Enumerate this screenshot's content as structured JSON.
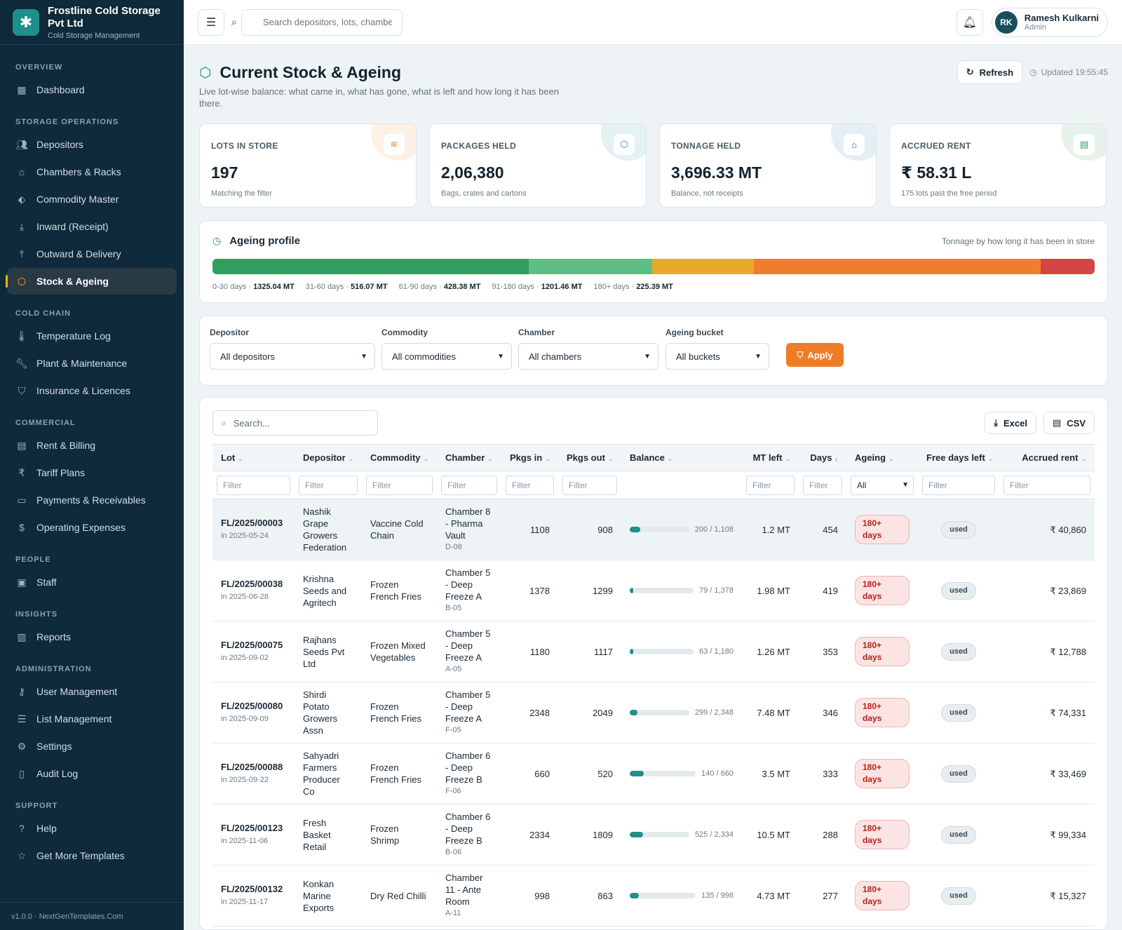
{
  "brand": {
    "name": "Frostline Cold Storage Pvt Ltd",
    "subtitle": "Cold Storage Management"
  },
  "sidebar": {
    "sections": [
      {
        "label": "OVERVIEW",
        "items": [
          {
            "label": "Dashboard",
            "icon": "dashboard-icon"
          }
        ]
      },
      {
        "label": "STORAGE OPERATIONS",
        "items": [
          {
            "label": "Depositors",
            "icon": "users-icon"
          },
          {
            "label": "Chambers & Racks",
            "icon": "warehouse-icon"
          },
          {
            "label": "Commodity Master",
            "icon": "tag-icon"
          },
          {
            "label": "Inward (Receipt)",
            "icon": "download-icon"
          },
          {
            "label": "Outward & Delivery",
            "icon": "upload-icon"
          },
          {
            "label": "Stock & Ageing",
            "icon": "box-icon",
            "active": true
          }
        ]
      },
      {
        "label": "COLD CHAIN",
        "items": [
          {
            "label": "Temperature Log",
            "icon": "thermometer-icon"
          },
          {
            "label": "Plant & Maintenance",
            "icon": "wrench-icon"
          },
          {
            "label": "Insurance & Licences",
            "icon": "shield-icon"
          }
        ]
      },
      {
        "label": "COMMERCIAL",
        "items": [
          {
            "label": "Rent & Billing",
            "icon": "receipt-icon"
          },
          {
            "label": "Tariff Plans",
            "icon": "rupee-icon"
          },
          {
            "label": "Payments & Receivables",
            "icon": "wallet-icon"
          },
          {
            "label": "Operating Expenses",
            "icon": "dollar-icon"
          }
        ]
      },
      {
        "label": "PEOPLE",
        "items": [
          {
            "label": "Staff",
            "icon": "id-card-icon"
          }
        ]
      },
      {
        "label": "INSIGHTS",
        "items": [
          {
            "label": "Reports",
            "icon": "bar-chart-icon"
          }
        ]
      },
      {
        "label": "ADMINISTRATION",
        "items": [
          {
            "label": "User Management",
            "icon": "key-icon"
          },
          {
            "label": "List Management",
            "icon": "list-icon"
          },
          {
            "label": "Settings",
            "icon": "gear-icon"
          },
          {
            "label": "Audit Log",
            "icon": "clipboard-icon"
          }
        ]
      },
      {
        "label": "SUPPORT",
        "items": [
          {
            "label": "Help",
            "icon": "help-icon"
          },
          {
            "label": "Get More Templates",
            "icon": "star-icon"
          }
        ]
      }
    ],
    "footer": "v1.0.0 · NextGenTemplates.Com"
  },
  "topbar": {
    "search_placeholder": "Search depositors, lots, chambers",
    "user": {
      "initials": "RK",
      "name": "Ramesh Kulkarni",
      "role": "Admin"
    }
  },
  "page": {
    "title": "Current Stock & Ageing",
    "description": "Live lot-wise balance: what came in, what has gone, what is left and how long it has been there.",
    "refresh_label": "Refresh",
    "updated": "Updated 19:55:45"
  },
  "kpis": [
    {
      "label": "LOTS IN STORE",
      "value": "197",
      "sub": "Matching the filter",
      "icon": "layers-icon",
      "tint": "#fdf1e6",
      "color": "#ef7d26"
    },
    {
      "label": "PACKAGES HELD",
      "value": "2,06,380",
      "sub": "Bags, crates and cartons",
      "icon": "box-icon",
      "tint": "#e4f2f3",
      "color": "#1f8f8a"
    },
    {
      "label": "TONNAGE HELD",
      "value": "3,696.33 MT",
      "sub": "Balance, not receipts",
      "icon": "warehouse-icon",
      "tint": "#e6eef5",
      "color": "#2b5f8a"
    },
    {
      "label": "ACCRUED RENT",
      "value": "₹ 58.31 L",
      "sub": "175 lots past the free period",
      "icon": "receipt-icon",
      "tint": "#e7f3ea",
      "color": "#2f9a55"
    }
  ],
  "ageing": {
    "title": "Ageing profile",
    "note": "Tonnage by how long it has been in store",
    "buckets": [
      {
        "label": "0-30 days",
        "value": 1325.04,
        "display": "1325.04 MT",
        "color": "#2f9e5f"
      },
      {
        "label": "31-60 days",
        "value": 516.07,
        "display": "516.07 MT",
        "color": "#5cbf86"
      },
      {
        "label": "61-90 days",
        "value": 428.38,
        "display": "428.38 MT",
        "color": "#eaa928"
      },
      {
        "label": "91-180 days",
        "value": 1201.46,
        "display": "1201.46 MT",
        "color": "#ef7d2e"
      },
      {
        "label": "180+ days",
        "value": 225.39,
        "display": "225.39 MT",
        "color": "#d64545"
      }
    ]
  },
  "filters": {
    "depositor": {
      "label": "Depositor",
      "value": "All depositors"
    },
    "commodity": {
      "label": "Commodity",
      "value": "All commodities"
    },
    "chamber": {
      "label": "Chamber",
      "value": "All chambers"
    },
    "bucket": {
      "label": "Ageing bucket",
      "value": "All buckets"
    },
    "apply_label": "Apply"
  },
  "table": {
    "search_placeholder": "Search...",
    "excel_label": "Excel",
    "csv_label": "CSV",
    "columns": [
      "Lot",
      "Depositor",
      "Commodity",
      "Chamber",
      "Pkgs in",
      "Pkgs out",
      "Balance",
      "MT left",
      "Days",
      "Ageing",
      "Free days left",
      "Accrued rent"
    ],
    "filter_placeholder": "Filter",
    "ageing_filter_value": "All",
    "rows": [
      {
        "lot": "FL/2025/00003",
        "date": "in 2025-05-24",
        "depositor": "Nashik Grape Growers Federation",
        "commodity": "Vaccine Cold Chain",
        "chamber": "Chamber 8 - Pharma Vault",
        "code": "D-08",
        "pkgs_in": "1108",
        "pkgs_out": "908",
        "balance": 200,
        "total": 1108,
        "balance_text": "200 / 1,108",
        "mt": "1.2 MT",
        "days": "454",
        "ageing": "180+ days",
        "free": "used",
        "rent": "₹ 40,860"
      },
      {
        "lot": "FL/2025/00038",
        "date": "in 2025-06-28",
        "depositor": "Krishna Seeds and Agritech",
        "commodity": "Frozen French Fries",
        "chamber": "Chamber 5 - Deep Freeze A",
        "code": "B-05",
        "pkgs_in": "1378",
        "pkgs_out": "1299",
        "balance": 79,
        "total": 1378,
        "balance_text": "79 / 1,378",
        "mt": "1.98 MT",
        "days": "419",
        "ageing": "180+ days",
        "free": "used",
        "rent": "₹ 23,869"
      },
      {
        "lot": "FL/2025/00075",
        "date": "in 2025-09-02",
        "depositor": "Rajhans Seeds Pvt Ltd",
        "commodity": "Frozen Mixed Vegetables",
        "chamber": "Chamber 5 - Deep Freeze A",
        "code": "A-05",
        "pkgs_in": "1180",
        "pkgs_out": "1117",
        "balance": 63,
        "total": 1180,
        "balance_text": "63 / 1,180",
        "mt": "1.26 MT",
        "days": "353",
        "ageing": "180+ days",
        "free": "used",
        "rent": "₹ 12,788"
      },
      {
        "lot": "FL/2025/00080",
        "date": "in 2025-09-09",
        "depositor": "Shirdi Potato Growers Assn",
        "commodity": "Frozen French Fries",
        "chamber": "Chamber 5 - Deep Freeze A",
        "code": "F-05",
        "pkgs_in": "2348",
        "pkgs_out": "2049",
        "balance": 299,
        "total": 2348,
        "balance_text": "299 / 2,348",
        "mt": "7.48 MT",
        "days": "346",
        "ageing": "180+ days",
        "free": "used",
        "rent": "₹ 74,331"
      },
      {
        "lot": "FL/2025/00088",
        "date": "in 2025-09-22",
        "depositor": "Sahyadri Farmers Producer Co",
        "commodity": "Frozen French Fries",
        "chamber": "Chamber 6 - Deep Freeze B",
        "code": "F-06",
        "pkgs_in": "660",
        "pkgs_out": "520",
        "balance": 140,
        "total": 660,
        "balance_text": "140 / 660",
        "mt": "3.5 MT",
        "days": "333",
        "ageing": "180+ days",
        "free": "used",
        "rent": "₹ 33,469"
      },
      {
        "lot": "FL/2025/00123",
        "date": "in 2025-11-06",
        "depositor": "Fresh Basket Retail",
        "commodity": "Frozen Shrimp",
        "chamber": "Chamber 6 - Deep Freeze B",
        "code": "B-06",
        "pkgs_in": "2334",
        "pkgs_out": "1809",
        "balance": 525,
        "total": 2334,
        "balance_text": "525 / 2,334",
        "mt": "10.5 MT",
        "days": "288",
        "ageing": "180+ days",
        "free": "used",
        "rent": "₹ 99,334"
      },
      {
        "lot": "FL/2025/00132",
        "date": "in 2025-11-17",
        "depositor": "Konkan Marine Exports",
        "commodity": "Dry Red Chilli",
        "chamber": "Chamber 11 - Ante Room",
        "code": "A-11",
        "pkgs_in": "998",
        "pkgs_out": "863",
        "balance": 135,
        "total": 998,
        "balance_text": "135 / 998",
        "mt": "4.73 MT",
        "days": "277",
        "ageing": "180+ days",
        "free": "used",
        "rent": "₹ 15,327"
      }
    ]
  }
}
